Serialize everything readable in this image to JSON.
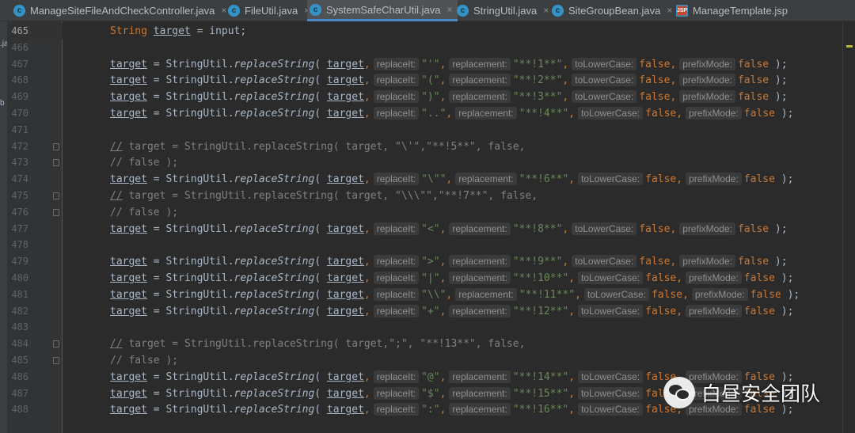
{
  "tabs": [
    {
      "label": "ManageSiteFileAndCheckController.java",
      "icon": "c",
      "active": false
    },
    {
      "label": "FileUtil.java",
      "icon": "c",
      "active": false
    },
    {
      "label": "SystemSafeCharUtil.java",
      "icon": "c",
      "active": true
    },
    {
      "label": "StringUtil.java",
      "icon": "c",
      "active": false
    },
    {
      "label": "SiteGroupBean.java",
      "icon": "c",
      "active": false
    },
    {
      "label": "ManageTemplate.jsp",
      "icon": "jsp",
      "active": false
    }
  ],
  "tab_close_glyph": "×",
  "side_fragments": [
    ".ja",
    "b"
  ],
  "current_line": "465",
  "lines": [
    {
      "no": "465",
      "kind": "decl",
      "text": "String target = input;"
    },
    {
      "no": "466",
      "kind": "empty"
    },
    {
      "no": "467",
      "kind": "call",
      "a": "\"'\"",
      "b": "\"**!1**\"",
      "lc": "false",
      "pm": "false"
    },
    {
      "no": "468",
      "kind": "call",
      "a": "\"(\"",
      "b": "\"**!2**\"",
      "lc": "false",
      "pm": "false"
    },
    {
      "no": "469",
      "kind": "call",
      "a": "\")\"",
      "b": "\"**!3**\"",
      "lc": "false",
      "pm": "false"
    },
    {
      "no": "470",
      "kind": "call",
      "a": "\"..\"",
      "b": "\"**!4**\"",
      "lc": "false",
      "pm": "false"
    },
    {
      "no": "471",
      "kind": "empty"
    },
    {
      "no": "472",
      "kind": "comment",
      "text": "// target = StringUtil.replaceString( target, \"\\'\",\"**!5**\", false,",
      "fold": true
    },
    {
      "no": "473",
      "kind": "comment2",
      "text": "// false );",
      "fold": true
    },
    {
      "no": "474",
      "kind": "call",
      "a": "\"\\\"\"",
      "b": "\"**!6**\"",
      "lc": "false",
      "pm": "false"
    },
    {
      "no": "475",
      "kind": "comment",
      "text": "// target = StringUtil.replaceString( target, \"\\\\\\\"\",\"**!7**\", false,",
      "fold": true
    },
    {
      "no": "476",
      "kind": "comment2",
      "text": "// false );",
      "fold": true
    },
    {
      "no": "477",
      "kind": "call",
      "a": "\"<\"",
      "b": "\"**!8**\"",
      "lc": "false",
      "pm": "false"
    },
    {
      "no": "478",
      "kind": "empty"
    },
    {
      "no": "479",
      "kind": "call",
      "a": "\">\"",
      "b": "\"**!9**\"",
      "lc": "false",
      "pm": "false"
    },
    {
      "no": "480",
      "kind": "call",
      "a": "\"|\"",
      "b": "\"**!10**\"",
      "lc": "false",
      "pm": "false"
    },
    {
      "no": "481",
      "kind": "call",
      "a": "\"\\\\\"",
      "b": "\"**!11**\"",
      "lc": "false",
      "pm": "false"
    },
    {
      "no": "482",
      "kind": "call",
      "a": "\"+\"",
      "b": "\"**!12**\"",
      "lc": "false",
      "pm": "false"
    },
    {
      "no": "483",
      "kind": "empty"
    },
    {
      "no": "484",
      "kind": "comment",
      "text": "// target = StringUtil.replaceString( target,\";\", \"**!13**\", false,",
      "fold": true
    },
    {
      "no": "485",
      "kind": "comment2",
      "text": "// false );",
      "fold": true
    },
    {
      "no": "486",
      "kind": "call",
      "a": "\"@\"",
      "b": "\"**!14**\"",
      "lc": "false",
      "pm": "false"
    },
    {
      "no": "487",
      "kind": "call",
      "a": "\"$\"",
      "b": "\"**!15**\"",
      "lc": "false",
      "pm": "false"
    },
    {
      "no": "488",
      "kind": "call",
      "a": "\":\"",
      "b": "\"**!16**\"",
      "lc": "false",
      "pm": "false"
    }
  ],
  "tokens": {
    "var": "target",
    "assign": " = ",
    "cls": "StringUtil.",
    "method": "replaceString",
    "open": "( ",
    "comma": ",",
    "close": " );",
    "hint_a": "replaceIt:",
    "hint_b": "replacement:",
    "hint_lc": "toLowerCase:",
    "hint_pm": "prefixMode:"
  },
  "watermark": {
    "text": "白昼安全团队",
    "icon": "wechat-icon"
  },
  "colors": {
    "bg": "#2b2b2b",
    "keyword": "#cc7832",
    "string": "#6a8759",
    "comment": "#808080",
    "text": "#a9b7c6",
    "active_tab_underline": "#4a88c7"
  }
}
